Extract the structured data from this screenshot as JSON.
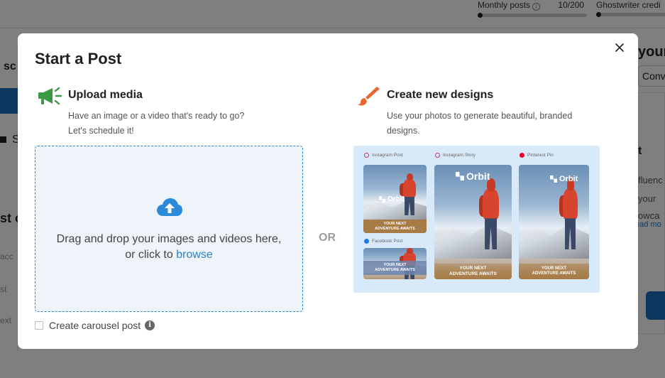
{
  "background": {
    "usage": [
      {
        "label": "Monthly posts",
        "value": "10/200"
      },
      {
        "label": "Ghostwriter credi",
        "value": ""
      }
    ],
    "fragments": {
      "left_sc": "sc",
      "left_s": "S",
      "left_st": "st c",
      "left_acc": "acc",
      "left_st2": "st",
      "left_ext": "ext",
      "right_your": "your",
      "right_conv": "Conv",
      "right_t": "t",
      "right_fluenc": "fluenc",
      "right_your2": "your",
      "right_owca": "owca",
      "right_ead": "ead mo"
    }
  },
  "modal": {
    "title": "Start a Post",
    "upload": {
      "title": "Upload media",
      "desc_line1": "Have an image or a video that's ready to go?",
      "desc_line2": "Let's schedule it!",
      "drop_text": "Drag and drop your images and videos here,",
      "drop_text2_prefix": "or click to ",
      "browse_link": "browse",
      "icon": "cloud-upload-icon"
    },
    "or_label": "OR",
    "create": {
      "title": "Create new designs",
      "desc_line1": "Use your photos to generate beautiful, branded",
      "desc_line2": "designs.",
      "icon": "paintbrush-icon",
      "preview": {
        "labels": {
          "instagram_post": "Instagram Post",
          "instagram_story": "Instagram Story",
          "pinterest_pin": "Pinterest Pin",
          "facebook_post": "Facebook Post"
        },
        "brand": "Orbit",
        "tagline_line1": "YOUR NEXT",
        "tagline_line2": "ADVENTURE AWAITS"
      }
    },
    "carousel_label": "Create carousel post",
    "carousel_checked": false,
    "colors": {
      "accent_blue": "#2d8ad8",
      "megaphone_green": "#3a9a43",
      "brush_orange": "#e8672f",
      "preview_bg": "#d8eaf9"
    }
  }
}
